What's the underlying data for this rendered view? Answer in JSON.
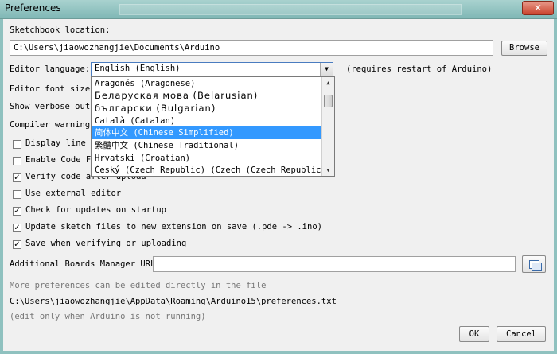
{
  "window": {
    "title": "Preferences",
    "close_glyph": "✕"
  },
  "sketchbook": {
    "label": "Sketchbook location:",
    "path": "C:\\Users\\jiaowozhangjie\\Documents\\Arduino",
    "browse_label": "Browse"
  },
  "language": {
    "label": "Editor language:",
    "selected": "English (English)",
    "note": "(requires restart of Arduino)",
    "options": [
      "Aragonés (Aragonese)",
      "Беларуская мова (Belarusian)",
      "български (Bulgarian)",
      "Català (Catalan)",
      "简体中文 (Chinese Simplified)",
      "繁體中文 (Chinese Traditional)",
      "Hrvatski (Croatian)",
      "Český (Czech Republic) (Czech (Czech Republic))"
    ],
    "highlighted_index": 4
  },
  "font_size": {
    "label": "Editor font size:"
  },
  "verbose": {
    "label": "Show verbose output"
  },
  "compiler": {
    "label": "Compiler warnings:"
  },
  "checkboxes": [
    {
      "label": "Display line nu",
      "checked": false
    },
    {
      "label": "Enable Code Fol",
      "checked": false
    },
    {
      "label": "Verify code after upload",
      "checked": true
    },
    {
      "label": "Use external editor",
      "checked": false
    },
    {
      "label": "Check for updates on startup",
      "checked": true
    },
    {
      "label": "Update sketch files to new extension on save (.pde -> .ino)",
      "checked": true
    },
    {
      "label": "Save when verifying or uploading",
      "checked": true
    }
  ],
  "boards": {
    "label": "Additional Boards Manager URLs:",
    "value": ""
  },
  "footer": {
    "more_info": "More preferences can be edited directly in the file",
    "prefs_path": "C:\\Users\\jiaowozhangjie\\AppData\\Roaming\\Arduino15\\preferences.txt",
    "note": "(edit only when Arduino is not running)"
  },
  "buttons": {
    "ok": "OK",
    "cancel": "Cancel"
  },
  "colors": {
    "selection": "#3399ff",
    "title_bar": "#8fc1bf",
    "close": "#c9432c"
  }
}
